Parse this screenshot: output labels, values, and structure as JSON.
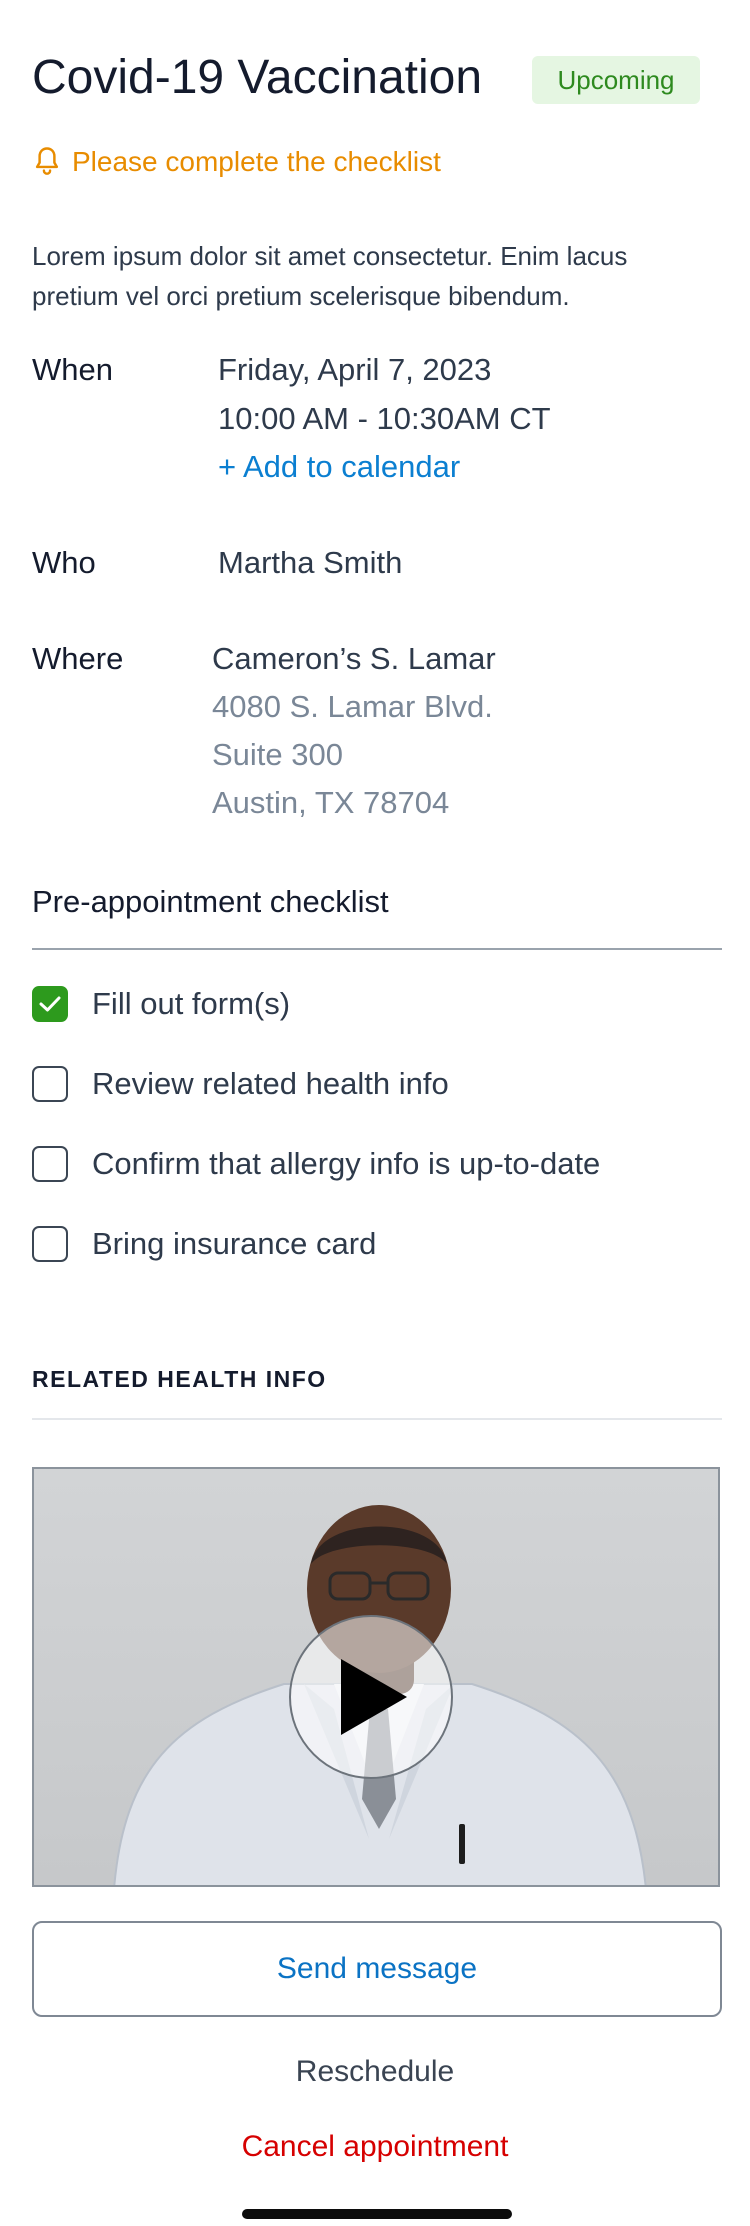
{
  "header": {
    "title": "Covid-19 Vaccination",
    "status_badge": "Upcoming"
  },
  "alert": {
    "icon": "bell-icon",
    "text": "Please complete the checklist",
    "color": "#e88c00"
  },
  "description": "Lorem ipsum dolor sit amet consectetur. Enim lacus pretium vel orci pretium scelerisque bibendum.",
  "details": {
    "when_label": "When",
    "date": "Friday, April 7, 2023",
    "time": "10:00 AM - 10:30AM CT",
    "add_calendar": "+ Add to calendar",
    "who_label": "Who",
    "who": "Martha Smith",
    "where_label": "Where",
    "location_name": "Cameron’s S. Lamar",
    "address_line1": "4080 S. Lamar Blvd.",
    "address_line2": "Suite 300",
    "address_line3": "Austin, TX 78704"
  },
  "checklist": {
    "title": "Pre-appointment checklist",
    "items": [
      {
        "label": "Fill out form(s)",
        "checked": true
      },
      {
        "label": "Review related health info",
        "checked": false
      },
      {
        "label": "Confirm that allergy info is up-to-date",
        "checked": false
      },
      {
        "label": "Bring insurance card",
        "checked": false
      }
    ]
  },
  "related": {
    "title": "RELATED HEALTH INFO",
    "video_icon": "play-icon"
  },
  "actions": {
    "send_message": "Send message",
    "reschedule": "Reschedule",
    "cancel": "Cancel appointment"
  },
  "colors": {
    "accent_blue": "#0b7fd1",
    "success_green": "#2d9a1d",
    "danger_red": "#d60000"
  }
}
